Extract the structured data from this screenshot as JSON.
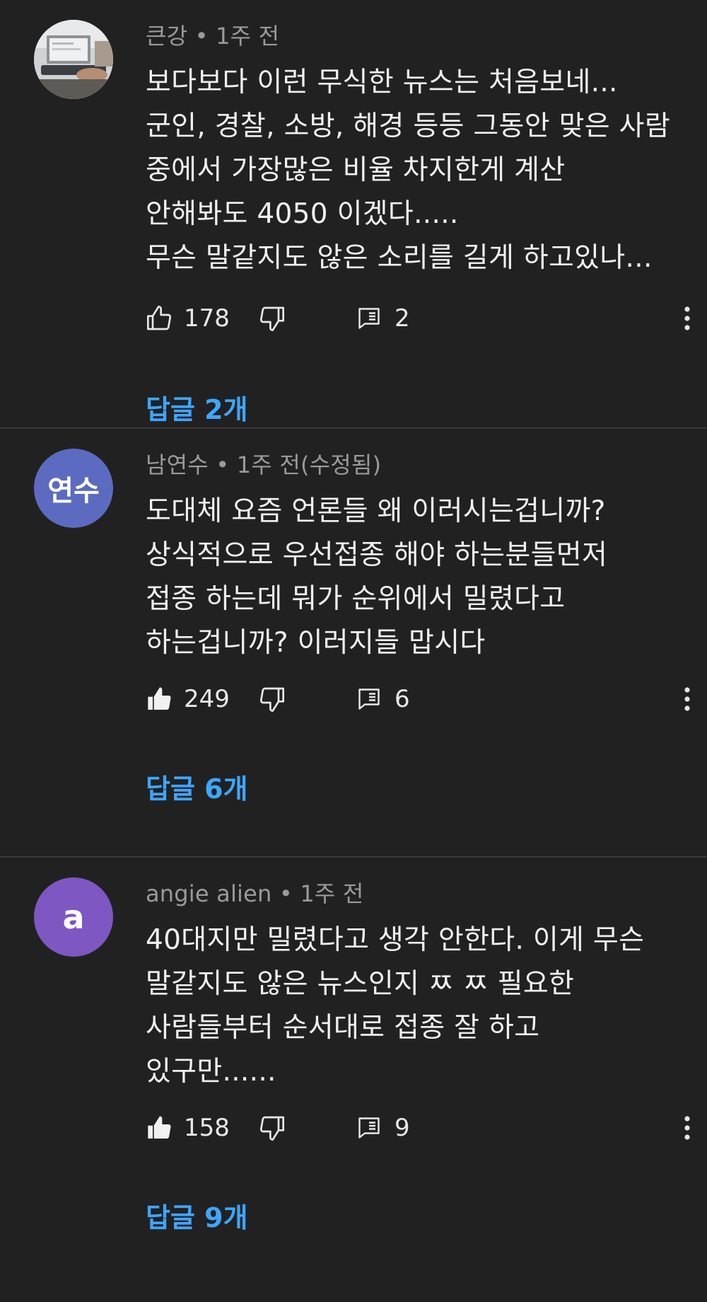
{
  "comments": [
    {
      "author": "큰강",
      "time": "1주 전",
      "avatar_type": "photo",
      "lines": [
        "보다보다 이런 무식한 뉴스는 처음보네...",
        "군인, 경찰, 소방, 해경 등등 그동안 맞은 사람",
        "중에서 가장많은 비율 차지한게 계산",
        "안해봐도 4050 이겠다.....",
        "무슨 말같지도 않은 소리를 길게 하고있나..."
      ],
      "likes": "178",
      "liked": false,
      "reply_count": "2",
      "replies_label": "답글 2개"
    },
    {
      "author": "남연수",
      "time": "1주 전(수정됨)",
      "avatar_type": "initials",
      "avatar_text": "연수",
      "avatar_color": "#5c6bc0",
      "lines": [
        "도대체 요즘 언론들 왜 이러시는겁니까?",
        "상식적으로 우선접종 해야 하는분들먼저",
        "접종 하는데 뭐가 순위에서 밀렸다고",
        "하는겁니까? 이러지들 맙시다"
      ],
      "likes": "249",
      "liked": true,
      "reply_count": "6",
      "replies_label": "답글 6개"
    },
    {
      "author": "angie alien",
      "time": "1주 전",
      "avatar_type": "initials",
      "avatar_text": "a",
      "avatar_color": "#7e57c2",
      "lines": [
        "40대지만 밀렸다고 생각 안한다. 이게 무슨",
        "말같지도 않은 뉴스인지 ㅉ ㅉ 필요한",
        "사람들부터 순서대로 접종 잘 하고",
        "있구만......"
      ],
      "likes": "158",
      "liked": true,
      "reply_count": "9",
      "replies_label": "답글 9개"
    }
  ],
  "colors": {
    "background": "#212121",
    "text": "#f1f1f1",
    "meta": "#9a9a9a",
    "link": "#3ea6ff",
    "divider": "#3a3a3a"
  },
  "icons": {
    "like": "thumb-up-icon",
    "dislike": "thumb-down-icon",
    "reply": "comment-icon",
    "more": "more-vert-icon"
  }
}
